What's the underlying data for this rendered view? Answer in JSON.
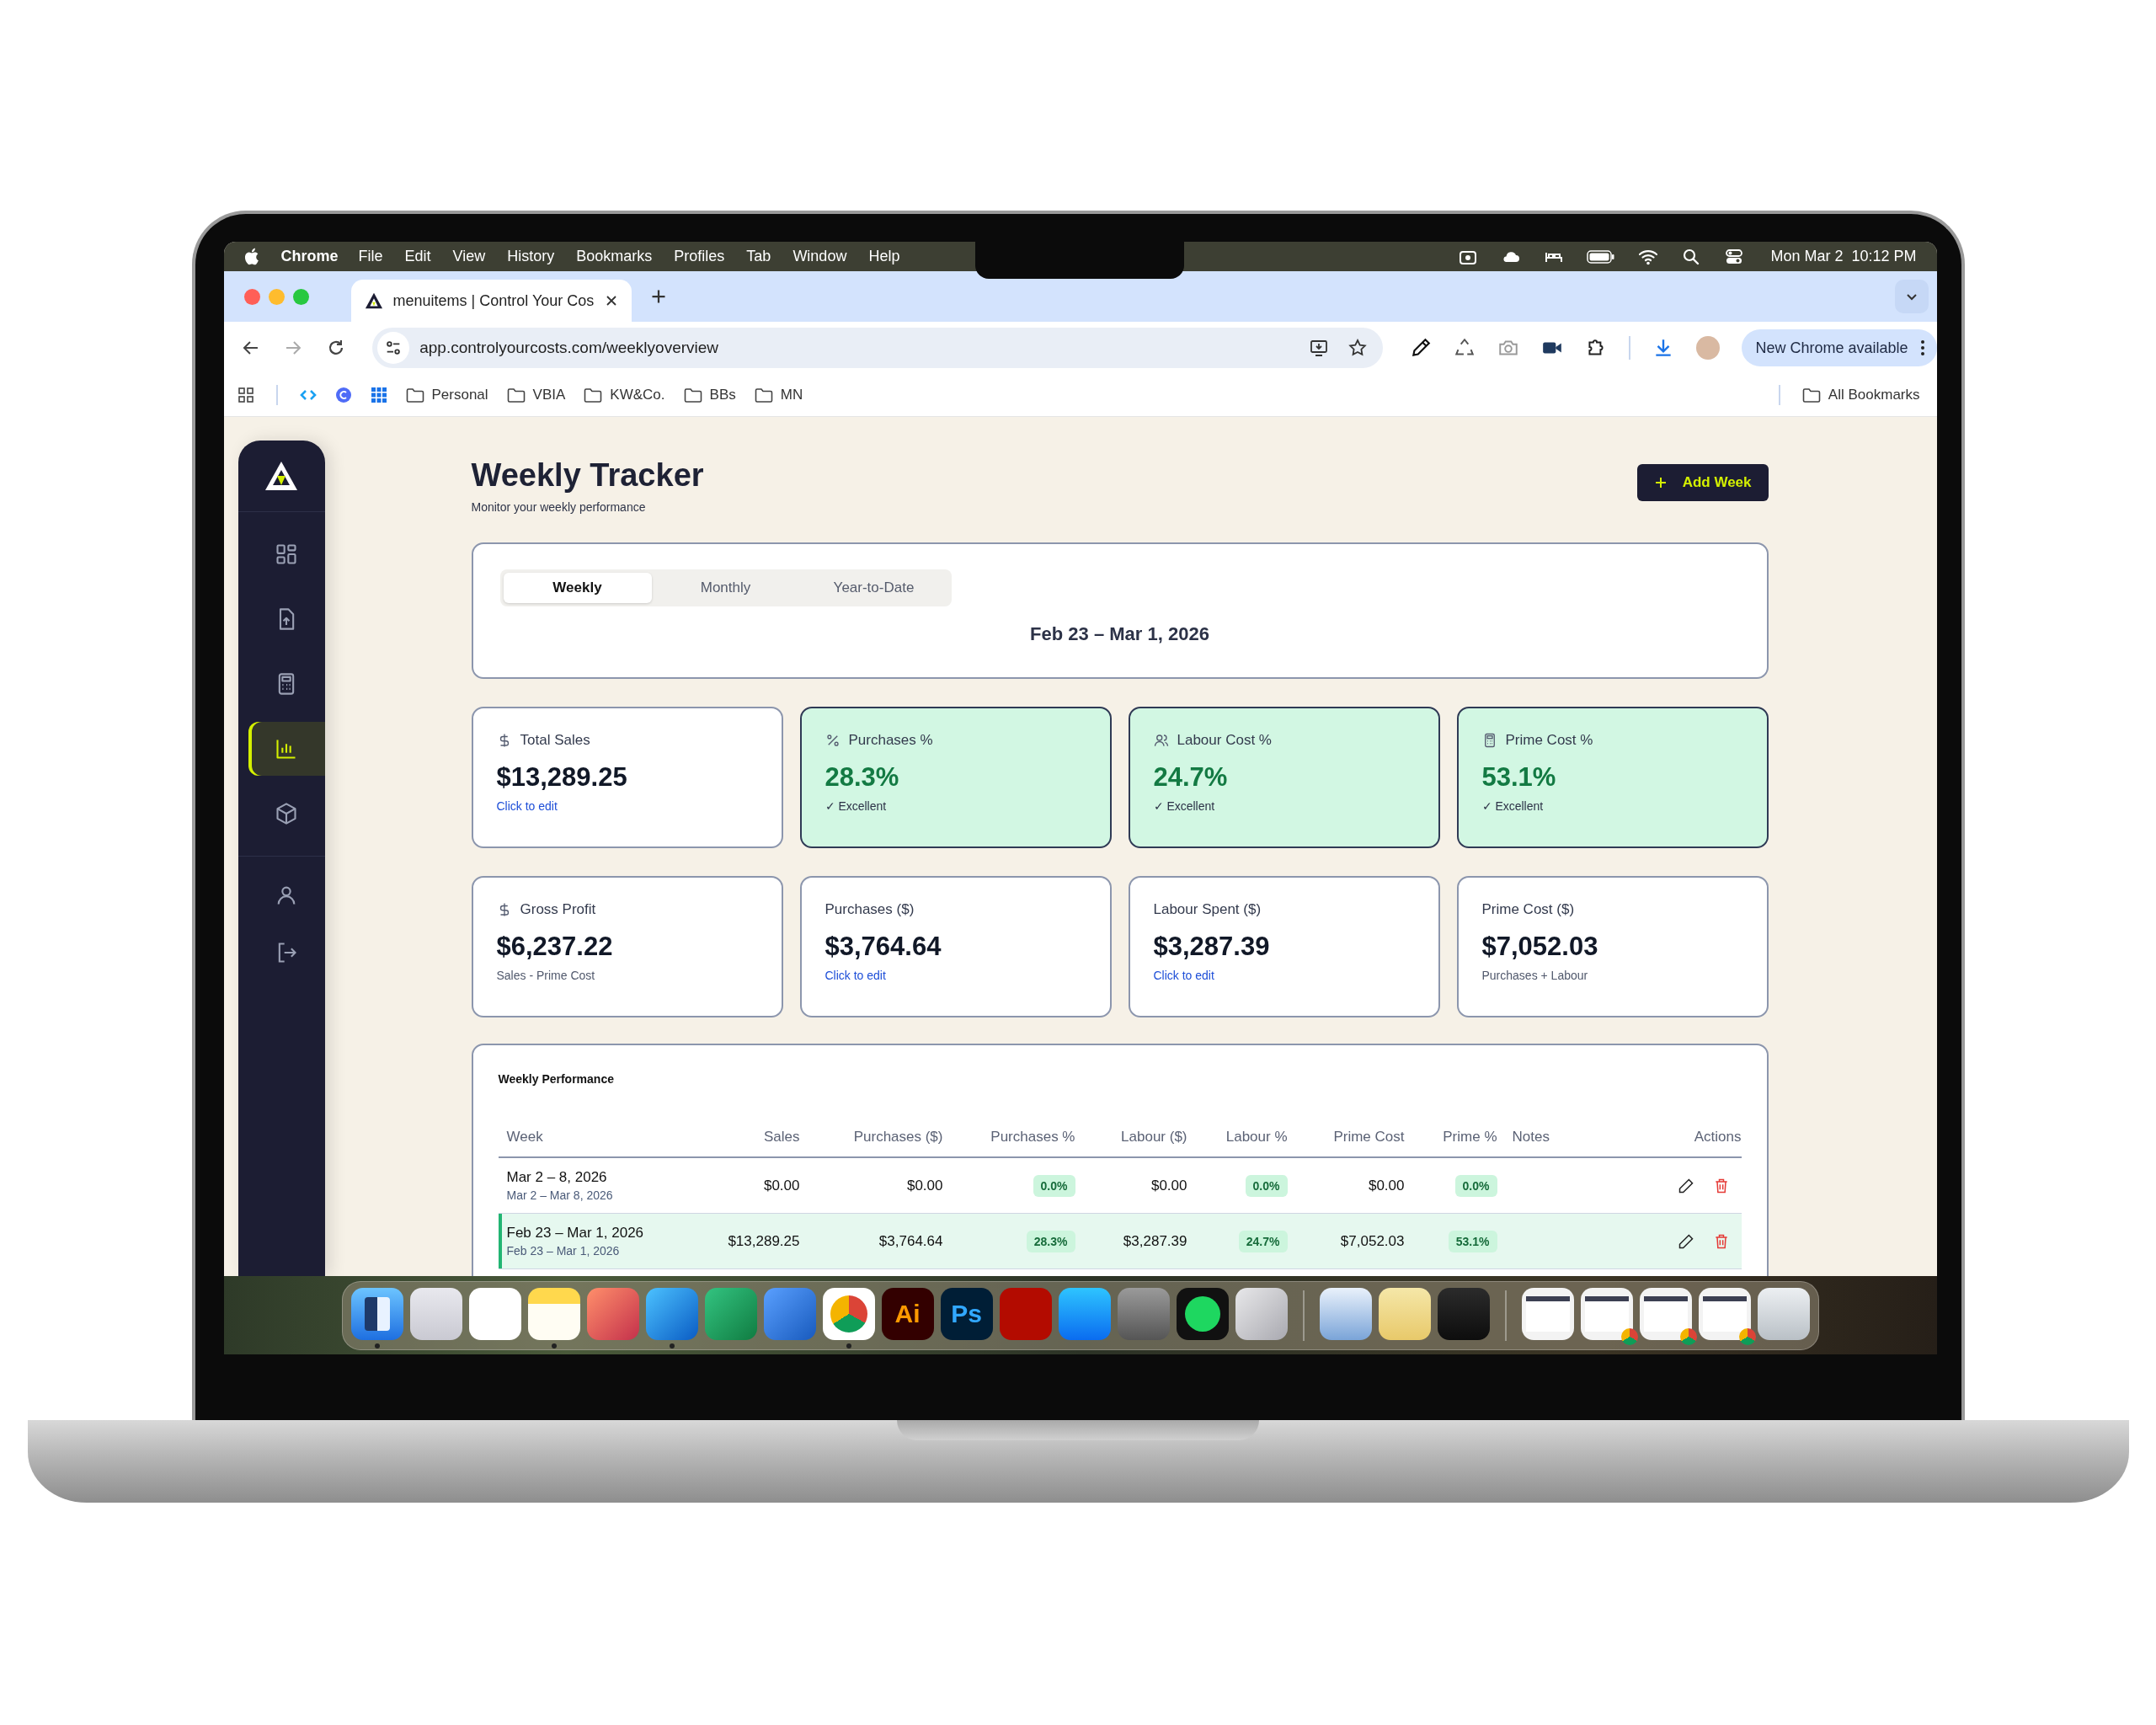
{
  "menu_bar": {
    "app": "Chrome",
    "items": [
      "File",
      "Edit",
      "View",
      "History",
      "Bookmarks",
      "Profiles",
      "Tab",
      "Window",
      "Help"
    ],
    "clock": "Mon Mar 2  10:12 PM"
  },
  "browser": {
    "tab": {
      "title": "menuitems | Control Your Cos",
      "selected": true
    },
    "url": "app.controlyourcosts.com/weeklyoverview",
    "update_button": "New Chrome available",
    "bookmarks": [
      {
        "kind": "arrows"
      },
      {
        "kind": "circle"
      },
      {
        "kind": "apps"
      },
      {
        "kind": "folder",
        "label": "Personal"
      },
      {
        "kind": "folder",
        "label": "VBIA"
      },
      {
        "kind": "folder",
        "label": "KW&Co."
      },
      {
        "kind": "folder",
        "label": "BBs"
      },
      {
        "kind": "folder",
        "label": "MN"
      }
    ],
    "all_bookmarks": "All Bookmarks"
  },
  "sidebar": {
    "items": [
      {
        "kind": "grid",
        "selected": false
      },
      {
        "kind": "upload",
        "selected": false
      },
      {
        "kind": "calculator",
        "selected": false
      },
      {
        "kind": "chart",
        "selected": true
      },
      {
        "kind": "box",
        "selected": false
      }
    ],
    "bottom_items": [
      {
        "kind": "user"
      },
      {
        "kind": "logout"
      }
    ]
  },
  "header": {
    "title": "Weekly Tracker",
    "subtitle": "Monitor your weekly performance",
    "add_button": "Add Week"
  },
  "period": {
    "tabs": [
      {
        "label": "Weekly",
        "selected": true
      },
      {
        "label": "Monthly",
        "selected": false
      },
      {
        "label": "Year-to-Date",
        "selected": false
      }
    ],
    "range": "Feb 23 – Mar 1, 2026"
  },
  "metrics": [
    {
      "kind": "dollar",
      "label": "Total Sales",
      "value": "$13,289.25",
      "note": "Click to edit",
      "note_link": true,
      "highlighted": false
    },
    {
      "kind": "percent",
      "label": "Purchases %",
      "value": "28.3%",
      "note": "✓ Excellent",
      "note_link": false,
      "highlighted": true
    },
    {
      "kind": "users",
      "label": "Labour Cost %",
      "value": "24.7%",
      "note": "✓ Excellent",
      "note_link": false,
      "highlighted": true
    },
    {
      "kind": "calculator",
      "label": "Prime Cost %",
      "value": "53.1%",
      "note": "✓ Excellent",
      "note_link": false,
      "highlighted": true
    },
    {
      "kind": "dollar",
      "label": "Gross Profit",
      "value": "$6,237.22",
      "note": "Sales - Prime Cost",
      "note_link": false,
      "highlighted": false
    },
    {
      "kind": "plain",
      "label": "Purchases ($)",
      "value": "$3,764.64",
      "note": "Click to edit",
      "note_link": true,
      "highlighted": false
    },
    {
      "kind": "plain",
      "label": "Labour Spent ($)",
      "value": "$3,287.39",
      "note": "Click to edit",
      "note_link": true,
      "highlighted": false
    },
    {
      "kind": "plain",
      "label": "Prime Cost ($)",
      "value": "$7,052.03",
      "note": "Purchases + Labour",
      "note_link": false,
      "highlighted": false
    }
  ],
  "performance": {
    "title": "Weekly Performance",
    "columns": [
      "Week",
      "Sales",
      "Purchases ($)",
      "Purchases %",
      "Labour ($)",
      "Labour %",
      "Prime Cost",
      "Prime %",
      "Notes",
      "Actions"
    ],
    "rows": [
      {
        "week": "Mar 2 – 8, 2026",
        "dates": "Mar 2 – Mar 8, 2026",
        "sales": "$0.00",
        "purchases": "$0.00",
        "purchases_pct": "0.0%",
        "labour": "$0.00",
        "labour_pct": "0.0%",
        "prime_cost": "$0.00",
        "prime_pct": "0.0%",
        "selected": false
      },
      {
        "week": "Feb 23 – Mar 1, 2026",
        "dates": "Feb 23 – Mar 1, 2026",
        "sales": "$13,289.25",
        "purchases": "$3,764.64",
        "purchases_pct": "28.3%",
        "labour": "$3,287.39",
        "labour_pct": "24.7%",
        "prime_cost": "$7,052.03",
        "prime_pct": "53.1%",
        "selected": true
      }
    ]
  },
  "dock": [
    {
      "kind": "finder",
      "running": true
    },
    {
      "kind": "launchpad",
      "running": false
    },
    {
      "kind": "photos",
      "running": false
    },
    {
      "kind": "notes",
      "running": true
    },
    {
      "kind": "powerpoint",
      "running": false
    },
    {
      "kind": "outlook",
      "running": true
    },
    {
      "kind": "excel",
      "running": false
    },
    {
      "kind": "word",
      "running": false
    },
    {
      "kind": "chrome",
      "running": true
    },
    {
      "kind": "illustrator",
      "label": "Ai",
      "running": false
    },
    {
      "kind": "photoshop",
      "label": "Ps",
      "running": false
    },
    {
      "kind": "acrobat",
      "running": false
    },
    {
      "kind": "appstore",
      "running": false
    },
    {
      "kind": "settings",
      "running": false
    },
    {
      "kind": "spotify",
      "running": false
    },
    {
      "kind": "phone",
      "running": false
    },
    {
      "kind": "separator"
    },
    {
      "kind": "preview",
      "running": false
    },
    {
      "kind": "notepad",
      "running": false
    },
    {
      "kind": "quicktime",
      "running": false
    },
    {
      "kind": "separator"
    },
    {
      "kind": "window",
      "badge": false
    },
    {
      "kind": "window",
      "badge": true
    },
    {
      "kind": "window",
      "badge": true
    },
    {
      "kind": "window",
      "badge": true
    },
    {
      "kind": "trash",
      "running": false
    }
  ]
}
